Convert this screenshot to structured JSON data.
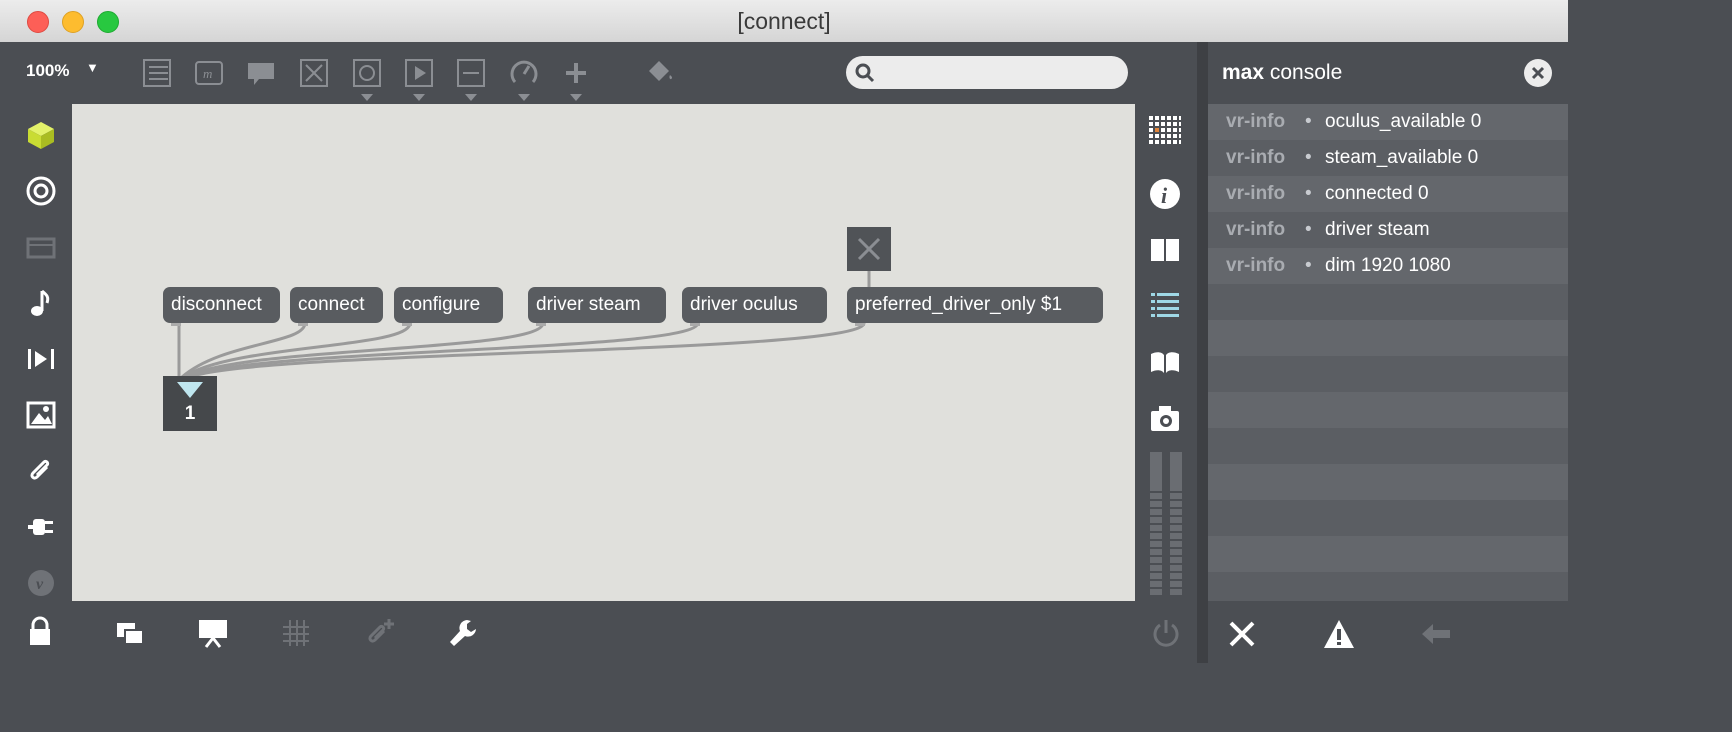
{
  "window": {
    "title": "[connect]"
  },
  "toolbar": {
    "zoom": "100%",
    "icons": [
      "bpatcher-icon",
      "comment-icon",
      "speech-bubble-icon",
      "toggle-icon",
      "button-icon",
      "playbar-icon",
      "slider-icon",
      "dial-icon",
      "plus-icon",
      "paint-bucket-icon"
    ],
    "search_placeholder": ""
  },
  "sidebar": {
    "icons": [
      "cube-icon",
      "target-icon",
      "patcher-icon",
      "music-note-icon",
      "media-play-icon",
      "image-icon",
      "paperclip-icon",
      "plug-icon",
      "vimeo-icon",
      "lock-icon"
    ]
  },
  "patch": {
    "messages": [
      {
        "id": "disconnect",
        "text": "disconnect"
      },
      {
        "id": "connect",
        "text": "connect"
      },
      {
        "id": "configure",
        "text": "configure"
      },
      {
        "id": "driver-steam",
        "text": "driver steam"
      },
      {
        "id": "driver-oculus",
        "text": "driver oculus"
      },
      {
        "id": "preferred-driver-only",
        "text": "preferred_driver_only $1"
      }
    ],
    "number_box": {
      "value": "1"
    }
  },
  "rightbar": {
    "icons": [
      "grid-icon",
      "info-icon",
      "book-open-icon",
      "list-icon",
      "reference-icon",
      "camera-icon",
      "meter-icon",
      "power-icon"
    ]
  },
  "bottombar": {
    "icons": [
      "windows-icon",
      "presentation-icon",
      "grid-icon",
      "paperclip-add-icon",
      "wrench-icon"
    ]
  },
  "console": {
    "title_bold": "max",
    "title_rest": " console",
    "rows": [
      {
        "source": "vr-info",
        "message": "oculus_available 0"
      },
      {
        "source": "vr-info",
        "message": "steam_available 0"
      },
      {
        "source": "vr-info",
        "message": "connected 0"
      },
      {
        "source": "vr-info",
        "message": "driver steam"
      },
      {
        "source": "vr-info",
        "message": "dim 1920 1080"
      }
    ],
    "footer_icons": [
      "clear-icon",
      "warning-icon",
      "back-arrow-icon"
    ]
  },
  "colors": {
    "chrome": "#4b4e53",
    "canvas": "#e0e0dc",
    "message_box": "#595c60",
    "accent_cube": "#d4e83a",
    "numbox_triangle": "#bfe6ef"
  }
}
